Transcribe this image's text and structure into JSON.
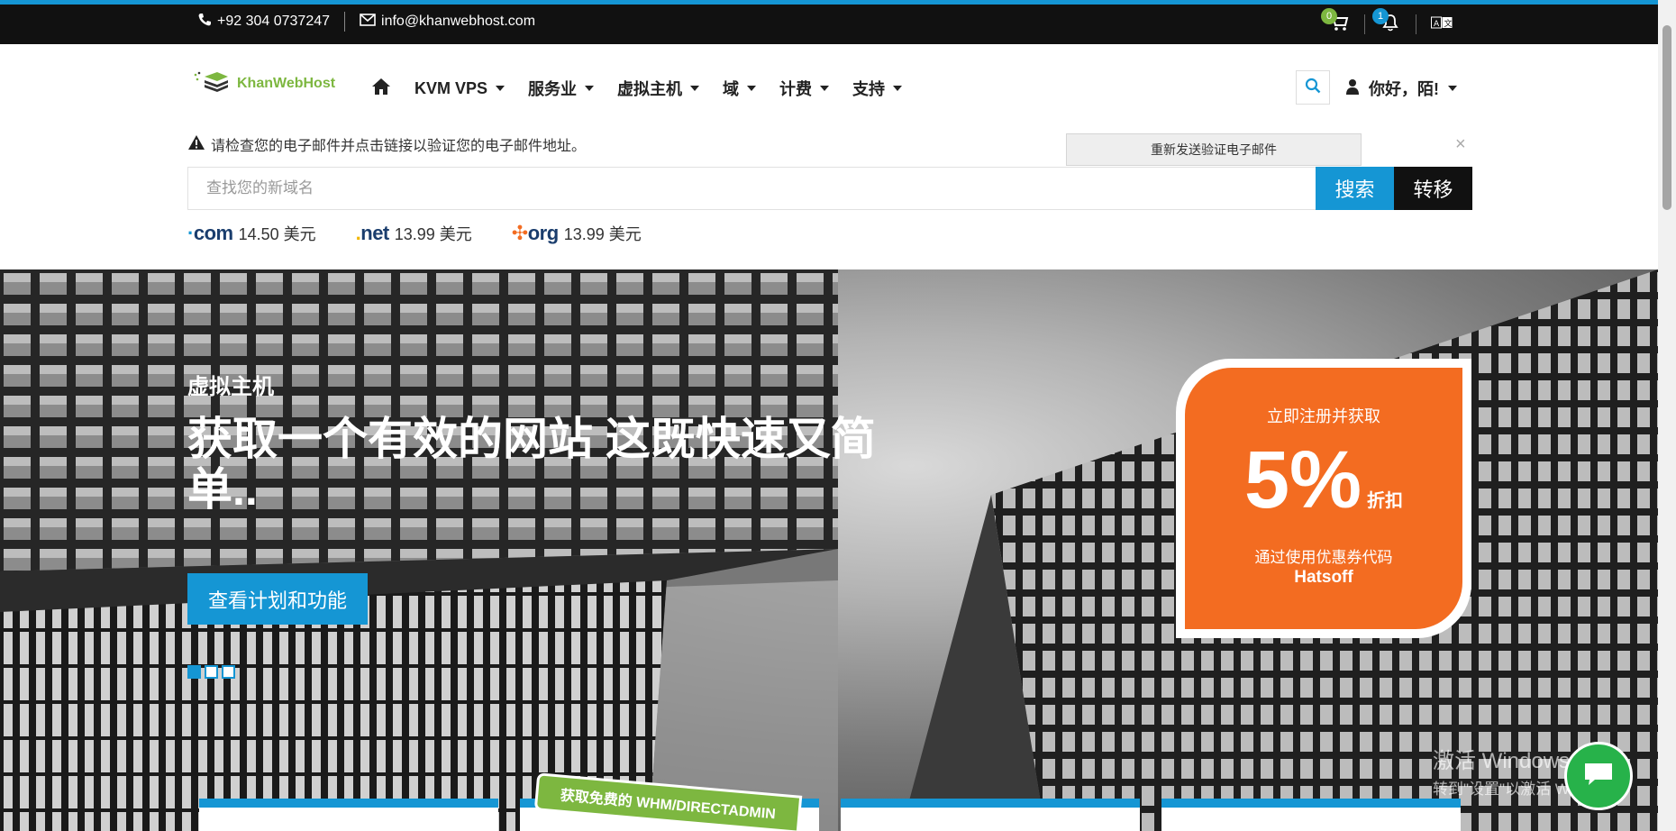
{
  "topbar": {
    "phone": "+92 304 0737247",
    "email": "info@khanwebhost.com",
    "cart_count": "0",
    "notification_count": "1",
    "icons": {
      "phone": "phone-icon",
      "email": "envelope-icon",
      "cart": "cart-icon",
      "bell": "bell-icon",
      "language": "language-icon"
    }
  },
  "brand": {
    "name": "KhanWebHost",
    "color": "#7db740"
  },
  "nav": {
    "items": [
      {
        "label": "KVM VPS"
      },
      {
        "label": "服务业"
      },
      {
        "label": "虚拟主机"
      },
      {
        "label": "域"
      },
      {
        "label": "计费"
      },
      {
        "label": "支持"
      }
    ],
    "user_greeting": "你好，陌!"
  },
  "verify": {
    "message": "请检查您的电子邮件并点击链接以验证您的电子邮件地址。",
    "resend_label": "重新发送验证电子邮件",
    "close": "×"
  },
  "domain_search": {
    "placeholder": "查找您的新域名",
    "search_label": "搜索",
    "transfer_label": "转移"
  },
  "tlds": [
    {
      "name": "com",
      "price": "14.50 美元"
    },
    {
      "name": "net",
      "price": "13.99 美元"
    },
    {
      "name": "org",
      "price": "13.99 美元"
    }
  ],
  "hero": {
    "subtitle": "虚拟主机",
    "headline": "获取一个有效的网站 这既快速又简单..",
    "cta": "查看计划和功能",
    "slides_total": 3,
    "active_slide": 1
  },
  "promo": {
    "line1": "立即注册并获取",
    "percent": "5%",
    "suffix": "折扣",
    "line2": "通过使用优惠券代码",
    "code": "Hatsoff"
  },
  "ribbon": "获取免费的 WHM/DIRECTADMIN",
  "watermark": {
    "title": "激活 Windows",
    "subtitle": "转到\"设置\"以激活 Windows。"
  },
  "colors": {
    "accent": "#1596d4",
    "green": "#7db740",
    "orange": "#f36c21",
    "dark": "#111111"
  }
}
